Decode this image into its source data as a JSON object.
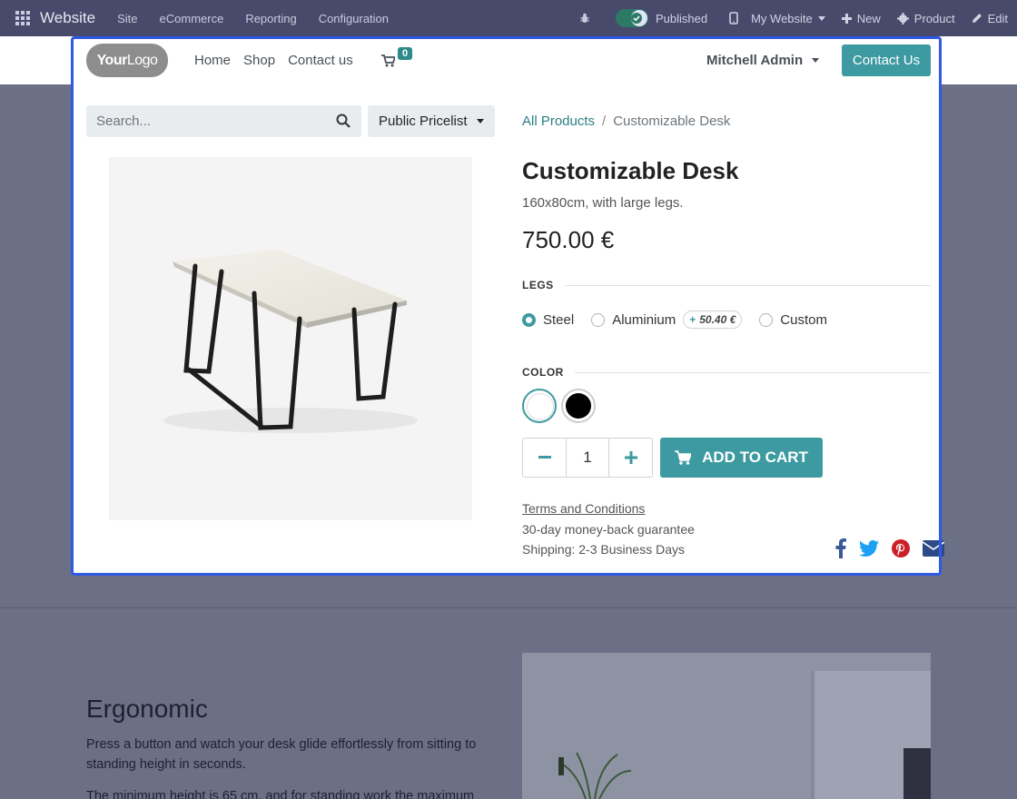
{
  "adminbar": {
    "app_name": "Website",
    "menus": [
      "Site",
      "eCommerce",
      "Reporting",
      "Configuration"
    ],
    "published_label": "Published",
    "my_website_label": "My Website",
    "new_label": "New",
    "product_label": "Product",
    "edit_label": "Edit"
  },
  "navbar": {
    "logo_bold": "Your",
    "logo_light": "Logo",
    "links": [
      "Home",
      "Shop",
      "Contact us"
    ],
    "cart_count": "0",
    "user_label": "Mitchell Admin",
    "contact_button": "Contact Us"
  },
  "search": {
    "placeholder": "Search...",
    "pricelist": "Public Pricelist"
  },
  "breadcrumb": {
    "root": "All Products",
    "separator": "/",
    "current": "Customizable Desk"
  },
  "product": {
    "name": "Customizable Desk",
    "description": "160x80cm, with large legs.",
    "price": "750.00 €",
    "legs_heading": "LEGS",
    "legs_options": [
      {
        "label": "Steel",
        "selected": true
      },
      {
        "label": "Aluminium",
        "selected": false,
        "extra_plus": "+",
        "extra_price": "50.40 €"
      },
      {
        "label": "Custom",
        "selected": false
      }
    ],
    "color_heading": "COLOR",
    "colors": [
      {
        "name": "white",
        "value": "#ffffff",
        "selected": true
      },
      {
        "name": "black",
        "value": "#000000",
        "selected": false
      }
    ],
    "quantity": "1",
    "add_to_cart": "ADD TO CART",
    "terms": "Terms and Conditions",
    "guarantee": "30-day money-back guarantee",
    "shipping": "Shipping: 2-3 Business Days"
  },
  "lower": {
    "title": "Ergonomic",
    "paragraph1": "Press a button and watch your desk glide effortlessly from sitting to standing height in seconds.",
    "paragraph2": "The minimum height is 65 cm, and for standing work the maximum"
  },
  "colors": {
    "accent": "#3c9aa0",
    "admin_bar": "#474a6b",
    "edit_outline": "#2d59e6"
  }
}
